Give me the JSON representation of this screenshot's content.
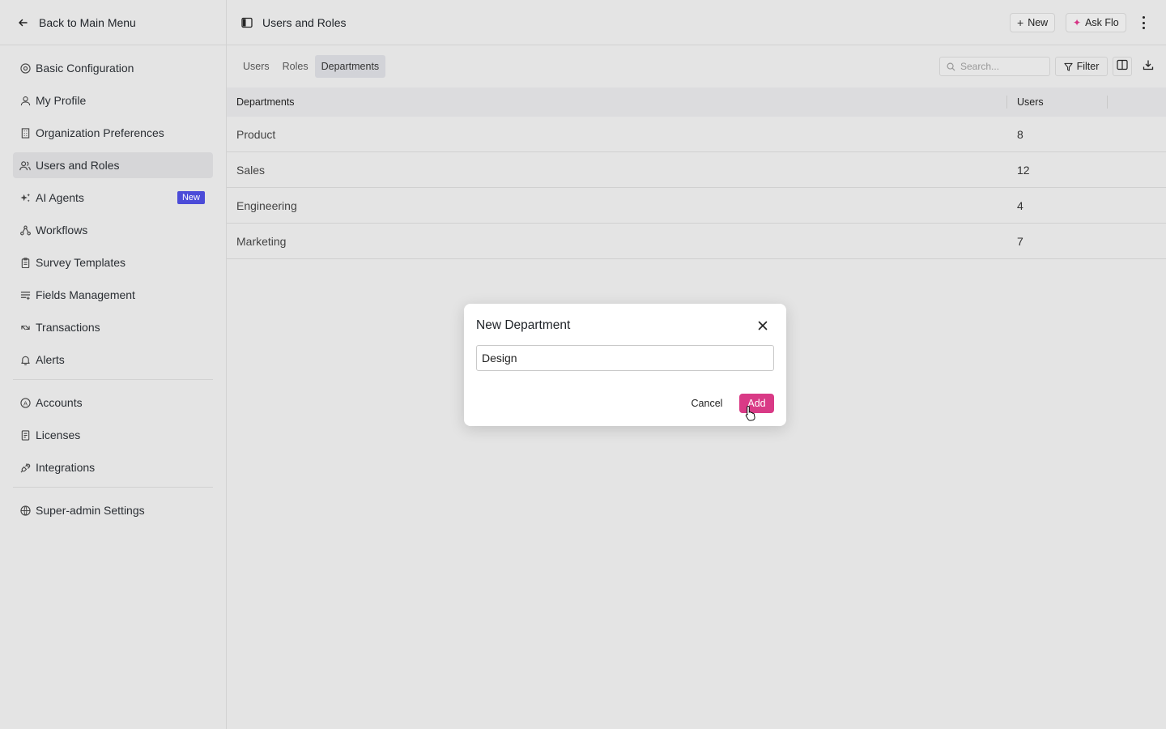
{
  "sidebar": {
    "back_label": "Back to Main Menu",
    "items": [
      {
        "label": "Basic Configuration",
        "icon": "settings-circle-icon"
      },
      {
        "label": "My Profile",
        "icon": "person-icon"
      },
      {
        "label": "Organization Preferences",
        "icon": "building-icon"
      },
      {
        "label": "Users and Roles",
        "icon": "users-icon",
        "active": true
      },
      {
        "label": "AI Agents",
        "icon": "sparkle-icon",
        "badge": "New"
      },
      {
        "label": "Workflows",
        "icon": "workflow-icon"
      },
      {
        "label": "Survey Templates",
        "icon": "clipboard-icon"
      },
      {
        "label": "Fields Management",
        "icon": "list-icon"
      },
      {
        "label": "Transactions",
        "icon": "transfer-icon"
      },
      {
        "label": "Alerts",
        "icon": "bell-icon"
      }
    ],
    "items2": [
      {
        "label": "Accounts",
        "icon": "account-icon"
      },
      {
        "label": "Licenses",
        "icon": "license-icon"
      },
      {
        "label": "Integrations",
        "icon": "plug-icon"
      }
    ],
    "items3": [
      {
        "label": "Super-admin Settings",
        "icon": "shield-icon"
      }
    ]
  },
  "header": {
    "title": "Users and Roles",
    "new_label": "New",
    "ask_label": "Ask Flo"
  },
  "toolbar": {
    "tabs": [
      {
        "label": "Users"
      },
      {
        "label": "Roles"
      },
      {
        "label": "Departments",
        "active": true
      }
    ],
    "search_placeholder": "Search...",
    "filter_label": "Filter"
  },
  "table": {
    "columns": [
      "Departments",
      "Users"
    ],
    "rows": [
      {
        "name": "Product",
        "users": "8"
      },
      {
        "name": "Sales",
        "users": "12"
      },
      {
        "name": "Engineering",
        "users": "4"
      },
      {
        "name": "Marketing",
        "users": "7"
      }
    ]
  },
  "modal": {
    "title": "New Department",
    "input_value": "Design",
    "cancel_label": "Cancel",
    "add_label": "Add"
  },
  "colors": {
    "accent": "#d93a86",
    "badge": "#4b4bd8"
  }
}
